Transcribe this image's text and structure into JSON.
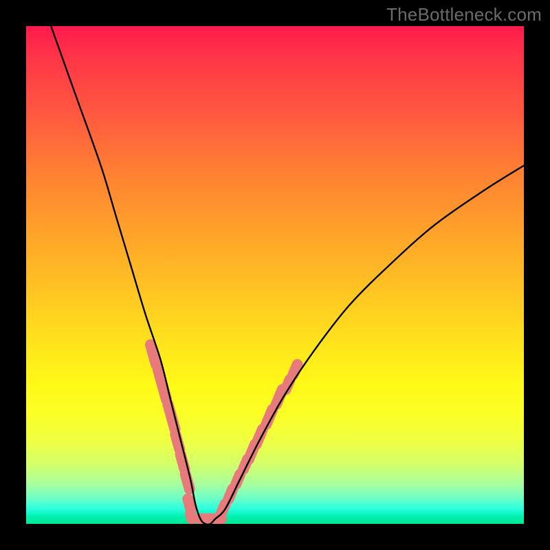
{
  "watermark": {
    "text": "TheBottleneck.com"
  },
  "chart_data": {
    "type": "line",
    "title": "",
    "xlabel": "",
    "ylabel": "",
    "xlim": [
      0,
      100
    ],
    "ylim": [
      0,
      100
    ],
    "note": "Axes are unlabeled in source image; x and y are percentage-of-plot coordinates (0–100). y=0 is the bottom green band; y=100 the top red edge. The single black curve is a V shape with a flat bottom near x≈35, reaching y≈0 there and rising steeply to both sides. Pink capsule markers sit along the two inner flanks of the V in the lower third of the plot.",
    "series": [
      {
        "name": "bottleneck-curve",
        "x": [
          5,
          10,
          15,
          18,
          21,
          24,
          27,
          29,
          31,
          33,
          34,
          35,
          36,
          37,
          38,
          40,
          43,
          47,
          52,
          58,
          65,
          73,
          82,
          92,
          100
        ],
        "y": [
          100,
          86,
          72,
          62,
          52,
          42,
          33,
          25,
          17,
          9,
          4,
          1,
          0,
          0,
          1,
          3,
          9,
          17,
          26,
          35,
          44,
          52,
          60,
          67,
          72
        ]
      }
    ],
    "markers": {
      "name": "pink-capsules",
      "color": "#e77a7a",
      "approx_segments_percent": [
        {
          "side": "left",
          "x": 25.0,
          "y_top": 36,
          "y_bot": 32
        },
        {
          "side": "left",
          "x": 26.5,
          "y_top": 31,
          "y_bot": 25
        },
        {
          "side": "left",
          "x": 28.5,
          "y_top": 24,
          "y_bot": 19
        },
        {
          "side": "left",
          "x": 30.0,
          "y_top": 18,
          "y_bot": 15
        },
        {
          "side": "left",
          "x": 31.0,
          "y_top": 14,
          "y_bot": 11
        },
        {
          "side": "left",
          "x": 32.0,
          "y_top": 10,
          "y_bot": 7
        },
        {
          "side": "left",
          "x": 32.5,
          "y_top": 5,
          "y_bot": 3
        },
        {
          "side": "left",
          "x": 33.0,
          "y_top": 2,
          "y_bot": 1
        },
        {
          "side": "flat",
          "x": 35.0,
          "y_top": 1,
          "y_bot": 0
        },
        {
          "side": "flat",
          "x": 37.0,
          "y_top": 1,
          "y_bot": 0
        },
        {
          "side": "right",
          "x": 40.0,
          "y_top": 4,
          "y_bot": 2
        },
        {
          "side": "right",
          "x": 41.5,
          "y_top": 7,
          "y_bot": 5
        },
        {
          "side": "right",
          "x": 43.0,
          "y_top": 10,
          "y_bot": 8
        },
        {
          "side": "right",
          "x": 44.5,
          "y_top": 13,
          "y_bot": 11
        },
        {
          "side": "right",
          "x": 46.0,
          "y_top": 16,
          "y_bot": 13
        },
        {
          "side": "right",
          "x": 47.5,
          "y_top": 19,
          "y_bot": 16
        },
        {
          "side": "right",
          "x": 49.5,
          "y_top": 23,
          "y_bot": 20
        },
        {
          "side": "right",
          "x": 51.5,
          "y_top": 27,
          "y_bot": 24
        },
        {
          "side": "right",
          "x": 53.0,
          "y_top": 29,
          "y_bot": 27
        },
        {
          "side": "right",
          "x": 54.5,
          "y_top": 32,
          "y_bot": 30
        }
      ]
    }
  }
}
